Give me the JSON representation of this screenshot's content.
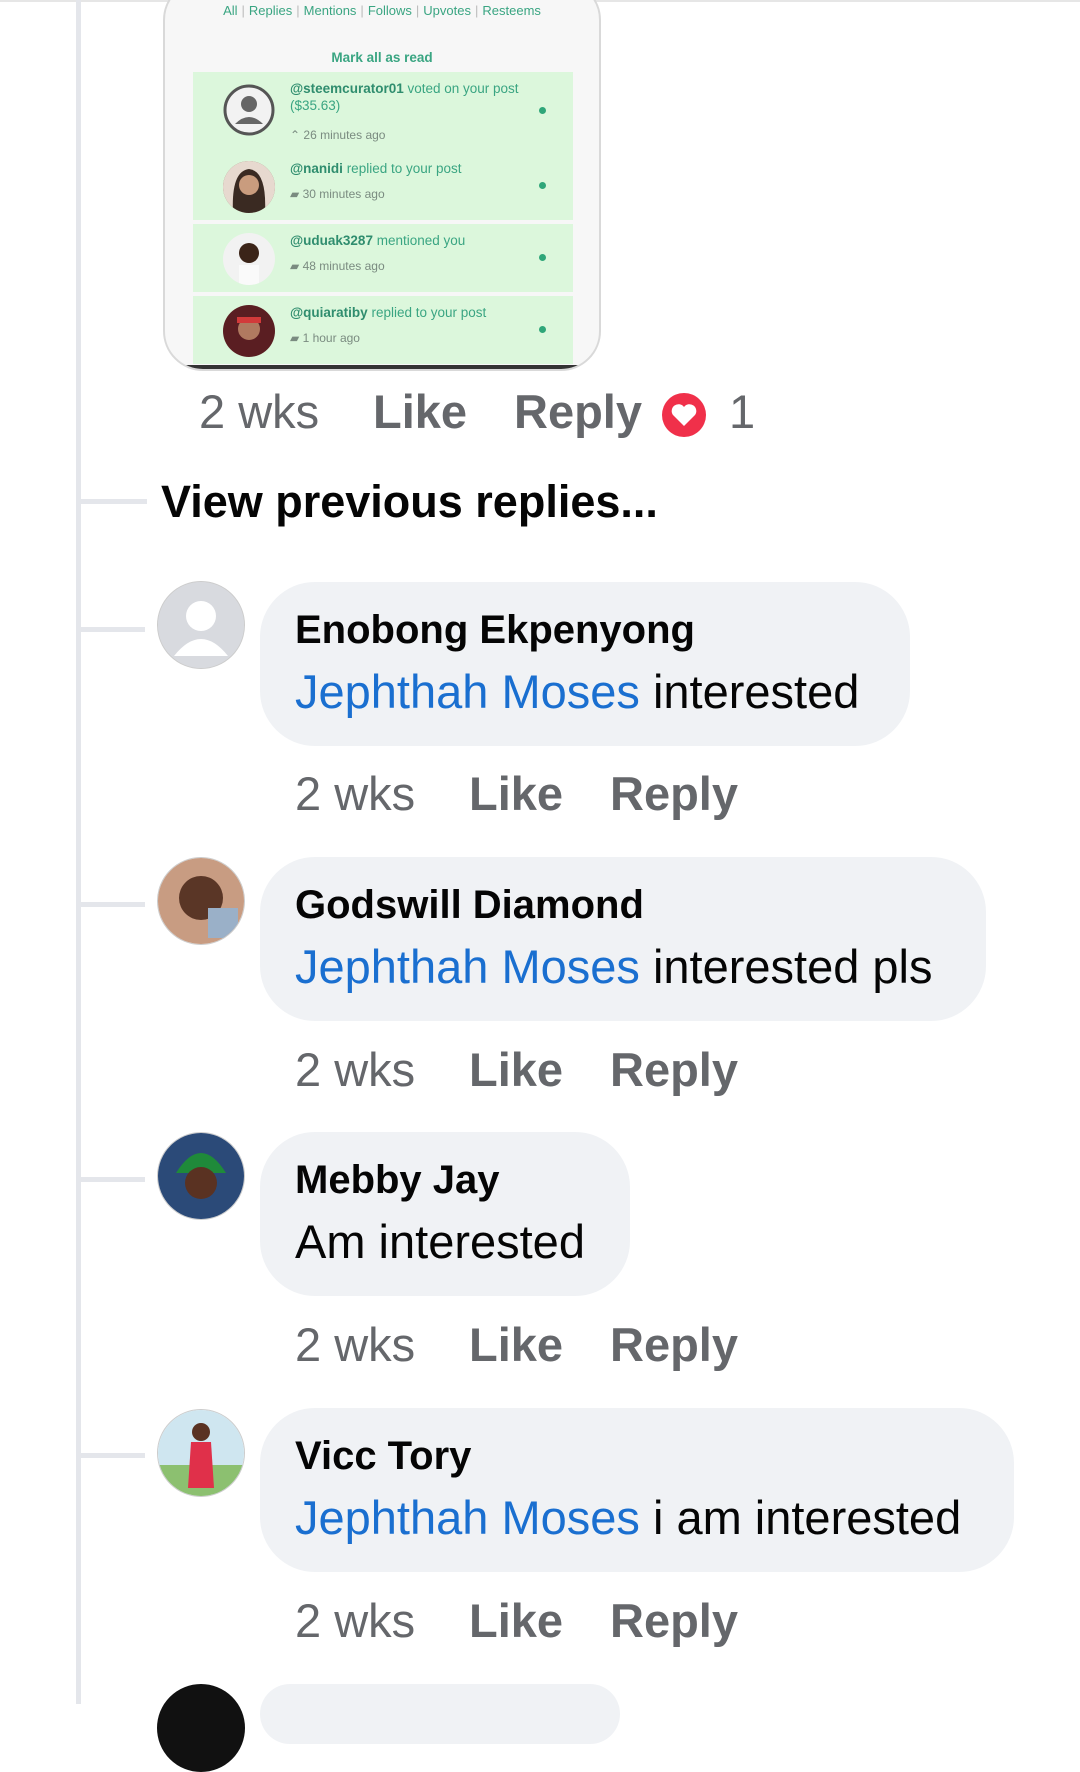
{
  "embedded_screenshot": {
    "tabs": [
      "All",
      "Replies",
      "Mentions",
      "Follows",
      "Upvotes",
      "Resteems"
    ],
    "mark_all_read": "Mark all as read",
    "notifications": [
      {
        "user": "@steemcurator01",
        "text": "voted on your post",
        "amount": "($35.63)",
        "time": "26 minutes ago",
        "icon": "upvote-icon"
      },
      {
        "user": "@nanidi",
        "text": "replied to your post",
        "time": "30 minutes ago",
        "icon": "comment-icon"
      },
      {
        "user": "@uduak3287",
        "text": "mentioned you",
        "time": "48 minutes ago",
        "icon": "mention-icon"
      },
      {
        "user": "@quiaratiby",
        "text": "replied to your post",
        "time": "1 hour ago",
        "icon": "comment-icon"
      }
    ]
  },
  "first_actions": {
    "time": "2 wks",
    "like": "Like",
    "reply": "Reply",
    "reaction_count": "1",
    "reaction_icon": "heart-icon"
  },
  "view_previous": "View previous replies...",
  "comments": [
    {
      "name": "Enobong Ekpenyong",
      "mention": "Jephthah Moses",
      "text": " interested",
      "time": "2 wks",
      "like": "Like",
      "reply": "Reply"
    },
    {
      "name": "Godswill Diamond",
      "mention": "Jephthah Moses",
      "text": " interested pls",
      "time": "2 wks",
      "like": "Like",
      "reply": "Reply"
    },
    {
      "name": "Mebby Jay",
      "mention": "",
      "text": "Am interested",
      "time": "2 wks",
      "like": "Like",
      "reply": "Reply"
    },
    {
      "name": "Vicc Tory",
      "mention": "Jephthah Moses",
      "text": " i am interested",
      "time": "2 wks",
      "like": "Like",
      "reply": "Reply"
    }
  ],
  "colors": {
    "mention": "#1a6fd0",
    "bubble": "#f0f2f5",
    "secondary_text": "#65676b",
    "accent_green": "#3aa582"
  }
}
